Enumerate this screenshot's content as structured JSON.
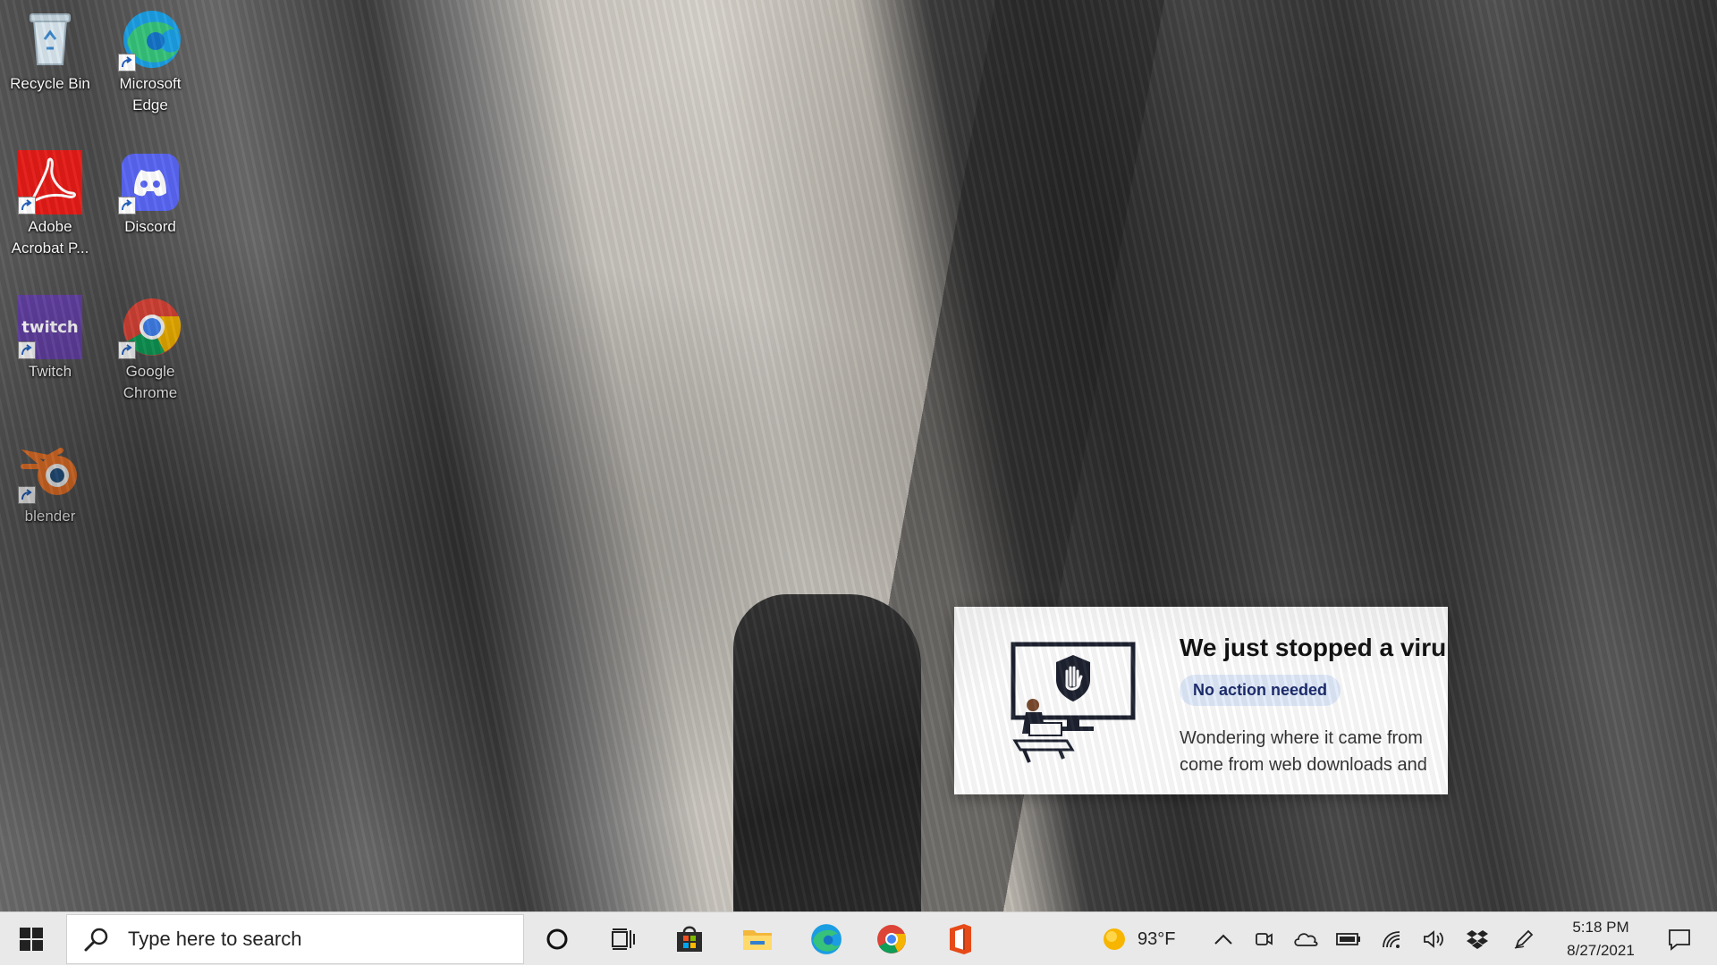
{
  "desktop": {
    "icons": [
      {
        "label": "Recycle Bin"
      },
      {
        "label": "Microsoft Edge"
      },
      {
        "label": "Adobe Acrobat P..."
      },
      {
        "label": "Discord"
      },
      {
        "label": "Twitch"
      },
      {
        "label": "Google Chrome"
      },
      {
        "label": "blender"
      }
    ]
  },
  "notification": {
    "title": "We just stopped a viru",
    "badge": "No action needed",
    "body_line1": "Wondering where it came from",
    "body_line2": "come from web downloads and"
  },
  "taskbar": {
    "search_placeholder": "Type here to search",
    "pinned": [
      "cortana-icon",
      "task-view-icon",
      "microsoft-store-icon",
      "file-explorer-icon",
      "edge-icon",
      "chrome-icon",
      "office-icon"
    ],
    "weather": {
      "temp": "93°F",
      "icon": "sun-icon"
    },
    "tray_icons": [
      "chevron-up-icon",
      "meet-now-icon",
      "onedrive-icon",
      "battery-icon",
      "wifi-icon",
      "volume-icon",
      "dropbox-icon",
      "pen-icon"
    ],
    "clock": {
      "time": "5:18 PM",
      "date": "8/27/2021"
    },
    "notifications_icon": "action-center-icon"
  },
  "colors": {
    "taskbar_bg": "#e9e9e9",
    "toast_badge_bg": "#e1ebfb",
    "toast_badge_text": "#1a2a6b",
    "twitch": "#6441a5",
    "discord": "#5865f2",
    "acrobat": "#e41b17",
    "blender": "#f5792a"
  }
}
